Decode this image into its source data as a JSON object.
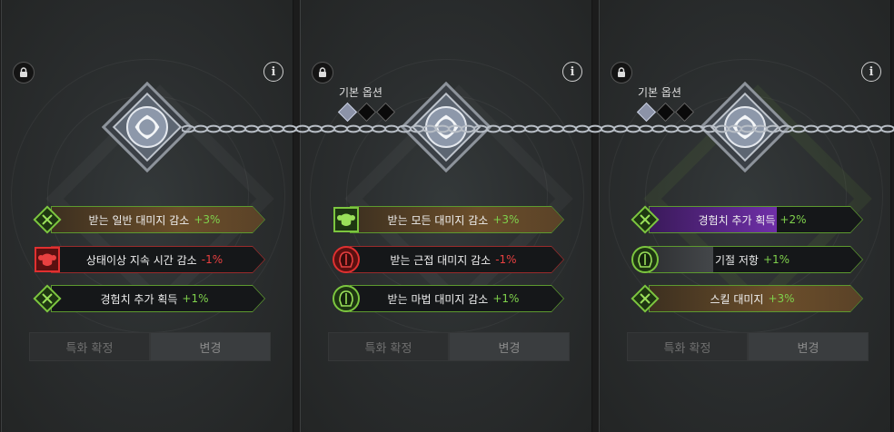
{
  "colors": {
    "positive": "#7fd14c",
    "negative": "#e84040",
    "brown_fill": "#6b4e2a",
    "purple_fill": "#6f2fa8",
    "green_border": "#5d9a2f",
    "red_border": "#9a2b2b"
  },
  "panels": [
    {
      "basic_label": "",
      "pips": [],
      "options": [
        {
          "icon": "green-diamond-icon",
          "label": "받는 일반 대미지 감소",
          "value": "+3%",
          "sign": "pos",
          "border": "green",
          "fill": "brown",
          "fill_fraction": 1.0
        },
        {
          "icon": "red-ram-icon",
          "label": "상태이상 지속 시간 감소",
          "value": "-1%",
          "sign": "neg",
          "border": "red",
          "fill": "none",
          "fill_fraction": 0.0
        },
        {
          "icon": "green-diamond-icon",
          "label": "경험치 추가 획득",
          "value": "+1%",
          "sign": "pos",
          "border": "green",
          "fill": "none",
          "fill_fraction": 0.0
        }
      ],
      "buttons": {
        "confirm": "특화 확정",
        "change": "변경"
      }
    },
    {
      "basic_label": "기본 옵션",
      "pips": [
        true,
        false,
        false
      ],
      "options": [
        {
          "icon": "green-ram-icon",
          "label": "받는 모든 대미지 감소",
          "value": "+3%",
          "sign": "pos",
          "border": "green",
          "fill": "brown",
          "fill_fraction": 1.0
        },
        {
          "icon": "red-helmet-icon",
          "label": "받는 근접 대미지 감소",
          "value": "-1%",
          "sign": "neg",
          "border": "red",
          "fill": "none",
          "fill_fraction": 0.0
        },
        {
          "icon": "green-helmet-icon",
          "label": "받는 마법 대미지 감소",
          "value": "+1%",
          "sign": "pos",
          "border": "green",
          "fill": "none",
          "fill_fraction": 0.0
        }
      ],
      "buttons": {
        "confirm": "특화 확정",
        "change": "변경"
      }
    },
    {
      "basic_label": "기본 옵션",
      "pips": [
        true,
        false,
        false
      ],
      "options": [
        {
          "icon": "green-diamond-icon",
          "label": "경험치 추가 획득",
          "value": "+2%",
          "sign": "pos",
          "border": "green",
          "fill": "purple",
          "fill_fraction": 0.6
        },
        {
          "icon": "green-helmet-icon",
          "label": "기절 저항",
          "value": "+1%",
          "sign": "pos",
          "border": "green",
          "fill": "grey",
          "fill_fraction": 0.3
        },
        {
          "icon": "green-diamond-icon",
          "label": "스킬 대미지",
          "value": "+3%",
          "sign": "pos",
          "border": "green",
          "fill": "brown",
          "fill_fraction": 1.0
        }
      ],
      "buttons": {
        "confirm": "특화 확정",
        "change": "변경"
      }
    }
  ]
}
